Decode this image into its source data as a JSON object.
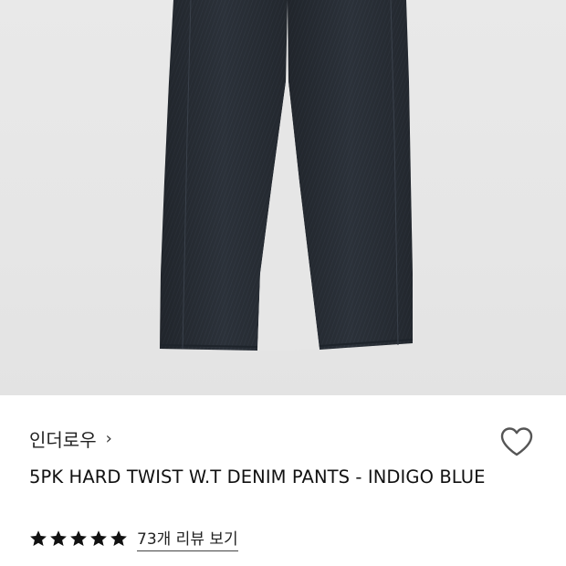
{
  "product": {
    "brand": "인더로우",
    "brand_chevron": "›",
    "title": "5PK HARD TWIST W.T DENIM PANTS - INDIGO BLUE",
    "rating_stars": 5,
    "review_link": "73개 리뷰 보기"
  },
  "icons": {
    "brand_chevron": "chevron-right-icon",
    "wishlist": "heart-outline-icon",
    "rating": "star-icon"
  },
  "colors": {
    "image_background": "#e7e7e7",
    "denim": "#2a3038",
    "star": "#111111",
    "heart_outline": "#555555"
  }
}
